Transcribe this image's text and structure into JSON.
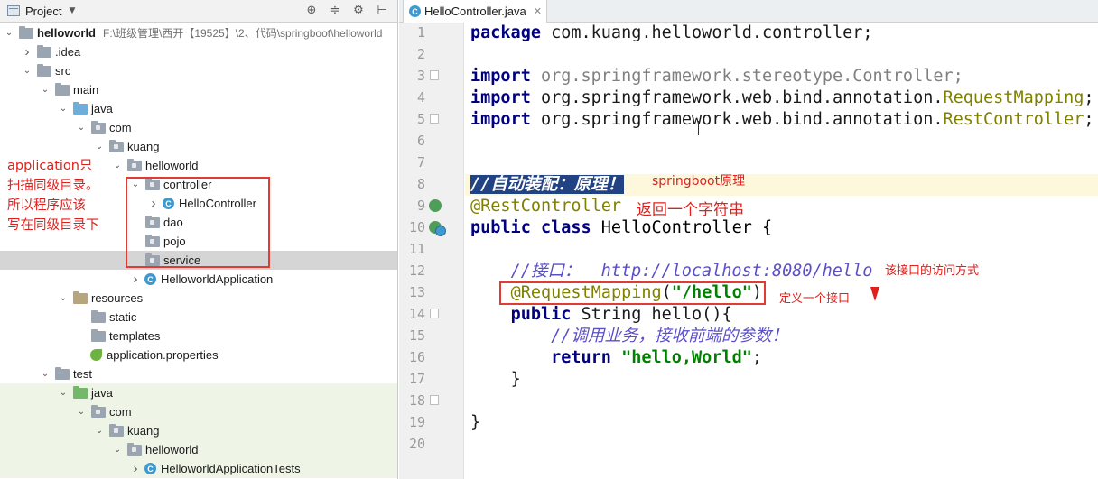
{
  "project_panel": {
    "title": "Project",
    "tree": [
      {
        "label": "helloworld",
        "hint": "F:\\班级管理\\西开【19525】\\2、代码\\springboot\\helloworld",
        "arrow": "open",
        "icon": "folder",
        "bold": true
      },
      {
        "label": ".idea",
        "arrow": "closed",
        "icon": "folder"
      },
      {
        "label": "src",
        "arrow": "open",
        "icon": "folder"
      },
      {
        "label": "main",
        "arrow": "open",
        "icon": "folder"
      },
      {
        "label": "java",
        "arrow": "open",
        "icon": "folder-blue"
      },
      {
        "label": "com",
        "arrow": "open",
        "icon": "package"
      },
      {
        "label": "kuang",
        "arrow": "open",
        "icon": "package"
      },
      {
        "label": "helloworld",
        "arrow": "open",
        "icon": "package"
      },
      {
        "label": "controller",
        "arrow": "open",
        "icon": "package"
      },
      {
        "label": "HelloController",
        "arrow": "closed",
        "icon": "class"
      },
      {
        "label": "dao",
        "arrow": "",
        "icon": "package"
      },
      {
        "label": "pojo",
        "arrow": "",
        "icon": "package"
      },
      {
        "label": "service",
        "arrow": "",
        "icon": "package",
        "selected": true
      },
      {
        "label": "HelloworldApplication",
        "arrow": "closed",
        "icon": "class"
      },
      {
        "label": "resources",
        "arrow": "open",
        "icon": "folder-res"
      },
      {
        "label": "static",
        "arrow": "",
        "icon": "folder"
      },
      {
        "label": "templates",
        "arrow": "",
        "icon": "folder"
      },
      {
        "label": "application.properties",
        "arrow": "",
        "icon": "spring"
      },
      {
        "label": "test",
        "arrow": "open",
        "icon": "folder"
      },
      {
        "label": "java",
        "arrow": "open",
        "icon": "folder-green",
        "test": true
      },
      {
        "label": "com",
        "arrow": "open",
        "icon": "package",
        "test": true
      },
      {
        "label": "kuang",
        "arrow": "open",
        "icon": "package",
        "test": true
      },
      {
        "label": "helloworld",
        "arrow": "open",
        "icon": "package",
        "test": true
      },
      {
        "label": "HelloworldApplicationTests",
        "arrow": "closed",
        "icon": "class",
        "test": true
      }
    ]
  },
  "annotations": {
    "left_note": [
      "application只",
      "扫描同级目录。",
      "所以程序应该",
      "写在同级目录下"
    ],
    "springboot_principle": "springboot原理",
    "return_string": "返回一个字符串",
    "access_method": "该接口的访问方式",
    "define_interface": "定义一个接口"
  },
  "editor": {
    "tab_label": "HelloController.java",
    "line_numbers": [
      "1",
      "2",
      "3",
      "4",
      "5",
      "6",
      "7",
      "8",
      "9",
      "10",
      "11",
      "12",
      "13",
      "14",
      "15",
      "16",
      "17",
      "18",
      "19",
      "20"
    ],
    "code": {
      "l1_kw": "package",
      "l1_rest": " com.kuang.helloworld.controller;",
      "l3_kw": "import",
      "l3_rest": " org.springframework.stereotype.Controller;",
      "l4_kw": "import",
      "l4_pre": " org.springframework.web.bind.annotation.",
      "l4_ann": "RequestMapping",
      "l4_end": ";",
      "l5_kw": "import",
      "l5_pre": " org.springframework.web.bind.annotation.",
      "l5_ann": "RestController",
      "l5_end": ";",
      "l8_cmt": "//自动装配：原理！",
      "l9_ann": "@RestController",
      "l10_kw": "public class",
      "l10_rest": " HelloController {",
      "l12_cmt": "//接口：  http://localhost:8080/hello",
      "l13_ann": "@RequestMapping",
      "l13_open": "(",
      "l13_str": "\"/hello\"",
      "l13_close": ")",
      "l14_kw": "public",
      "l14_rest": " String hello(){",
      "l15_cmt": "//调用业务，接收前端的参数！",
      "l16_kw": "return",
      "l16_str": " \"hello,World\"",
      "l16_end": ";",
      "l17": "}",
      "l19": "}"
    }
  }
}
